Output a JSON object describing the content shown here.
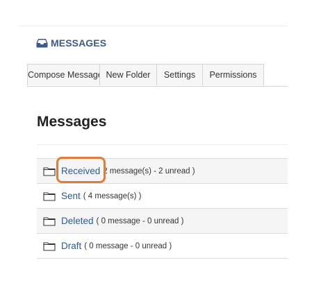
{
  "header": {
    "title": "MESSAGES",
    "icon": "inbox-tray-icon"
  },
  "nav": {
    "items": [
      {
        "label": "Compose Message"
      },
      {
        "label": "New Folder"
      },
      {
        "label": "Settings"
      },
      {
        "label": "Permissions"
      }
    ]
  },
  "main": {
    "title": "Messages",
    "folders": [
      {
        "name": "Received",
        "count": "2 message(s) - 2 unread )"
      },
      {
        "name": "Sent",
        "count": "( 4 message(s) )"
      },
      {
        "name": "Deleted",
        "count": "( 0 message - 0 unread )"
      },
      {
        "name": "Draft",
        "count": "( 0 message - 0 unread )"
      }
    ]
  },
  "annotation": {
    "highlight_color": "#e07b39",
    "highlighted_item": "Received"
  },
  "colors": {
    "link": "#2b5a97",
    "header_accent": "#3a5a87"
  }
}
